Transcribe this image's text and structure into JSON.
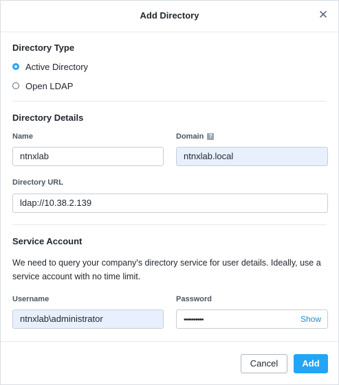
{
  "dialog": {
    "title": "Add Directory",
    "close_glyph": "✕"
  },
  "directory_type": {
    "heading": "Directory Type",
    "options": [
      {
        "label": "Active Directory",
        "selected": true
      },
      {
        "label": "Open LDAP",
        "selected": false
      }
    ]
  },
  "directory_details": {
    "heading": "Directory Details",
    "name_label": "Name",
    "name_value": "ntnxlab",
    "domain_label": "Domain",
    "domain_help_glyph": "?",
    "domain_value": "ntnxlab.local",
    "url_label": "Directory URL",
    "url_value": "ldap://10.38.2.139"
  },
  "service_account": {
    "heading": "Service Account",
    "description": "We need to query your company's directory service for user details. Ideally, use a service account with no time limit.",
    "username_label": "Username",
    "username_value": "ntnxlab\\administrator",
    "password_label": "Password",
    "password_masked": "••••••••••",
    "show_label": "Show"
  },
  "footer": {
    "cancel_label": "Cancel",
    "add_label": "Add"
  },
  "colors": {
    "accent": "#22a5f7",
    "link": "#1b8fd8",
    "autofill_bg": "#e8f0fe"
  },
  "icons": {
    "close": "close-icon",
    "help": "help-icon"
  }
}
